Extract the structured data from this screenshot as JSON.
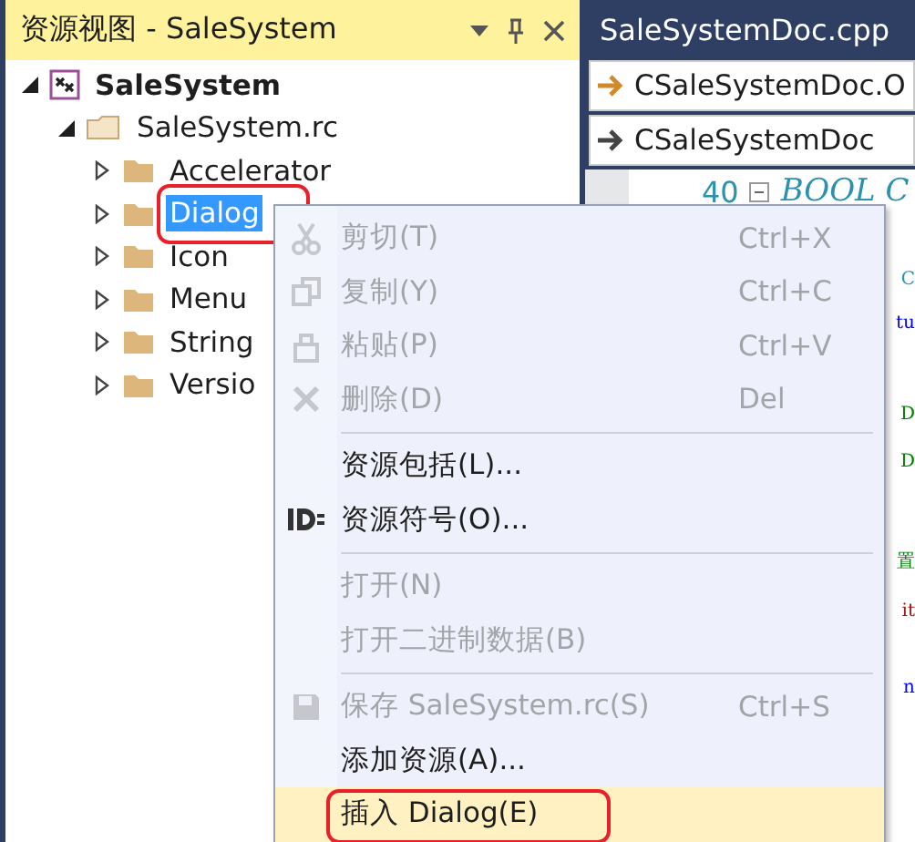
{
  "panel": {
    "title": "资源视图 - SaleSystem"
  },
  "tree": [
    {
      "label": "SaleSystem",
      "kind": "project",
      "expanded": true,
      "selected": false,
      "children": [
        {
          "label": "SaleSystem.rc",
          "kind": "rcfile",
          "expanded": true,
          "selected": false,
          "children": [
            {
              "label": "Accelerator",
              "kind": "folder",
              "expanded": false,
              "selected": false,
              "annotated": false
            },
            {
              "label": "Dialog",
              "kind": "folder",
              "expanded": false,
              "selected": true,
              "annotated": true
            },
            {
              "label": "Icon",
              "kind": "folder",
              "expanded": false,
              "selected": false,
              "annotated": false
            },
            {
              "label": "Menu",
              "kind": "folder",
              "expanded": false,
              "selected": false,
              "annotated": false
            },
            {
              "label": "String",
              "kind": "folder",
              "expanded": false,
              "selected": false,
              "annotated": false
            },
            {
              "label": "Versio",
              "kind": "folder",
              "expanded": false,
              "selected": false,
              "annotated": false
            }
          ]
        }
      ]
    }
  ],
  "editor": {
    "tab": "SaleSystemDoc.cpp",
    "class_dropdown": "CSaleSystemDoc.O",
    "member_dropdown": "CSaleSystemDoc",
    "line_number": "40",
    "line_text": "BOOL C",
    "fragments": [
      "C",
      "tu",
      "D",
      "D",
      "置",
      "it",
      "n"
    ]
  },
  "context_menu": [
    {
      "kind": "item",
      "label": "剪切(T)",
      "shortcut": "Ctrl+X",
      "disabled": true,
      "highlighted": false,
      "annotated": false
    },
    {
      "kind": "item",
      "label": "复制(Y)",
      "shortcut": "Ctrl+C",
      "disabled": true,
      "highlighted": false,
      "annotated": false
    },
    {
      "kind": "item",
      "label": "粘贴(P)",
      "shortcut": "Ctrl+V",
      "disabled": true,
      "highlighted": false,
      "annotated": false
    },
    {
      "kind": "item",
      "label": "删除(D)",
      "shortcut": "Del",
      "disabled": true,
      "highlighted": false,
      "annotated": false
    },
    {
      "kind": "separator"
    },
    {
      "kind": "item",
      "label": "资源包括(L)...",
      "disabled": false,
      "highlighted": false,
      "annotated": false
    },
    {
      "kind": "item",
      "label": "资源符号(O)...",
      "disabled": false,
      "highlighted": false,
      "annotated": false
    },
    {
      "kind": "separator"
    },
    {
      "kind": "item",
      "label": "打开(N)",
      "disabled": true,
      "highlighted": false,
      "annotated": false
    },
    {
      "kind": "item",
      "label": "打开二进制数据(B)",
      "disabled": true,
      "highlighted": false,
      "annotated": false
    },
    {
      "kind": "separator"
    },
    {
      "kind": "item",
      "label": "保存 SaleSystem.rc(S)",
      "shortcut": "Ctrl+S",
      "disabled": true,
      "highlighted": false,
      "annotated": false
    },
    {
      "kind": "item",
      "label": "添加资源(A)...",
      "disabled": false,
      "highlighted": false,
      "annotated": false
    },
    {
      "kind": "item",
      "label": "插入 Dialog(E)",
      "disabled": false,
      "highlighted": true,
      "annotated": true
    }
  ]
}
